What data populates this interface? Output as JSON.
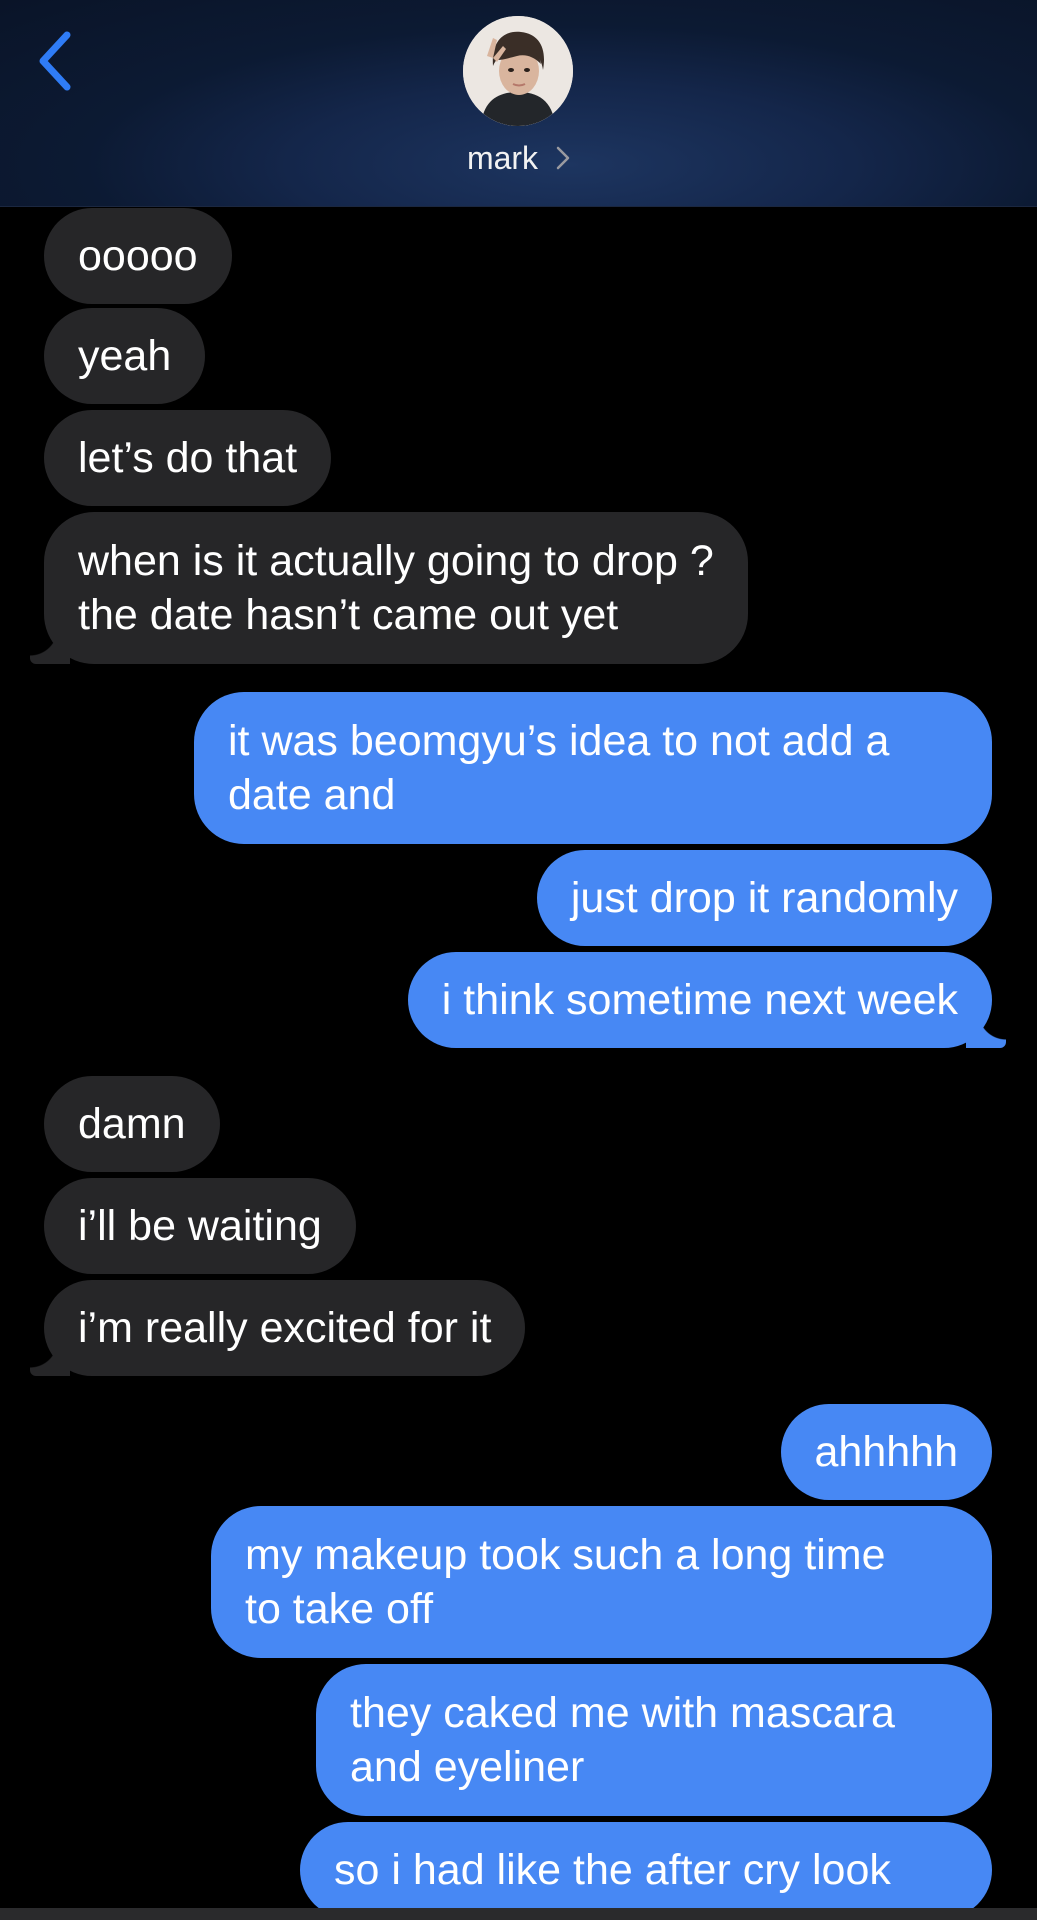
{
  "header": {
    "contact_name": "mark"
  },
  "messages": [
    {
      "from": "them",
      "lines": [
        "ooooo"
      ]
    },
    {
      "from": "them",
      "lines": [
        "yeah"
      ]
    },
    {
      "from": "them",
      "lines": [
        "let’s do that"
      ]
    },
    {
      "from": "them",
      "lines": [
        "when is it actually going to drop ?",
        "the date hasn’t came out yet"
      ]
    },
    {
      "from": "me",
      "lines": [
        "it was beomgyu’s idea to not add a",
        "date and"
      ]
    },
    {
      "from": "me",
      "lines": [
        "just drop it randomly"
      ]
    },
    {
      "from": "me",
      "lines": [
        "i think sometime next week"
      ]
    },
    {
      "from": "them",
      "lines": [
        "damn"
      ]
    },
    {
      "from": "them",
      "lines": [
        "i’ll be waiting"
      ]
    },
    {
      "from": "them",
      "lines": [
        "i’m really excited for it"
      ]
    },
    {
      "from": "me",
      "lines": [
        "ahhhhh"
      ]
    },
    {
      "from": "me",
      "lines": [
        "my makeup took such a long time",
        "to take off"
      ]
    },
    {
      "from": "me",
      "lines": [
        "they caked me with mascara",
        "and eyeliner"
      ]
    },
    {
      "from": "me",
      "lines": [
        "so i had like the after cry look"
      ]
    }
  ],
  "colors": {
    "sent_bubble": "#4788f4",
    "received_bubble": "#262628",
    "accent": "#2f7cf6"
  },
  "icons": {
    "back": "chevron-left-icon",
    "contact_chevron": "chevron-right-icon",
    "avatar": "contact-photo"
  }
}
